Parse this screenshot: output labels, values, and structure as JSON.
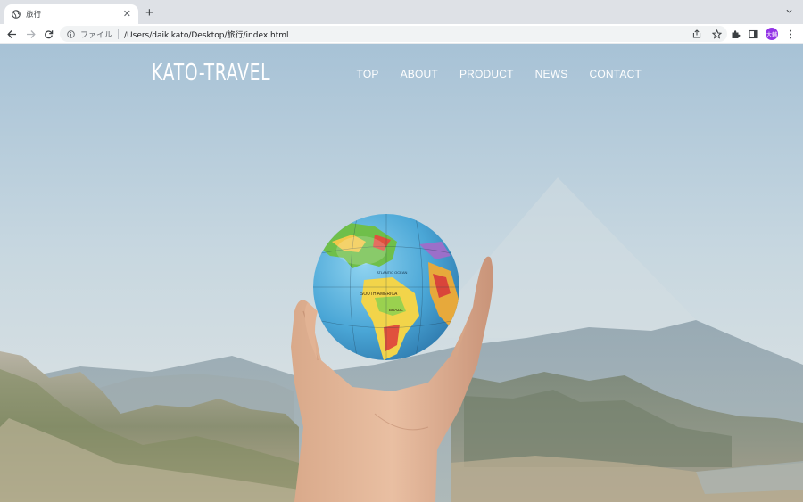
{
  "browser": {
    "tab": {
      "title": "旅行"
    },
    "address": {
      "scheme_label": "ファイル",
      "url": "/Users/daikikato/Desktop/旅行/index.html"
    },
    "profile_initials": "大輔"
  },
  "site": {
    "logo": "KATO-TRAVEL",
    "nav": [
      "TOP",
      "ABOUT",
      "PRODUCT",
      "NEWS",
      "CONTACT"
    ]
  },
  "hero": {
    "globe_labels": [
      "SOUTH AMERICA",
      "BRAZIL",
      "ATLANTIC OCEAN"
    ]
  },
  "colors": {
    "tabbar_bg": "#dee1e6",
    "avatar_bg": "#9334e6",
    "sky_top": "#a9c4d8",
    "sky_mid": "#c9d9e2",
    "nav_text": "#ffffff"
  },
  "icons": [
    "globe-icon",
    "close-icon",
    "plus-icon",
    "chevron-down-icon",
    "arrow-left-icon",
    "arrow-right-icon",
    "reload-icon",
    "info-icon",
    "share-icon",
    "star-icon",
    "puzzle-icon",
    "side-panel-icon",
    "more-vert-icon"
  ]
}
